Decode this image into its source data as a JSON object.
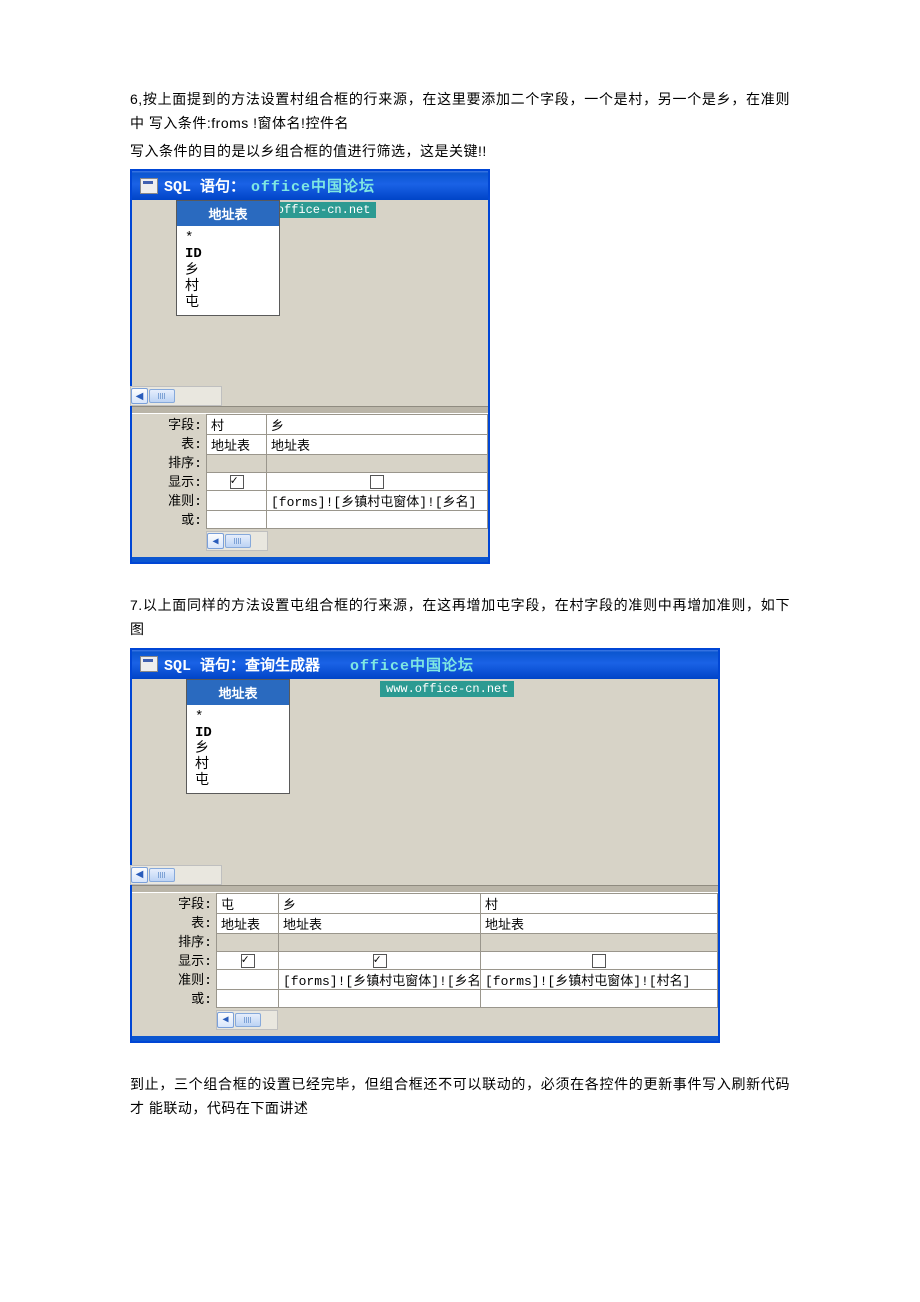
{
  "paragraphs": {
    "p1": "6,按上面提到的方法设置村组合框的行来源，在这里要添加二个字段，一个是村，另一个是乡，在准则中 写入条件:froms !窗体名!控件名",
    "p2": "写入条件的目的是以乡组合框的值进行筛选，这是关键!!",
    "p3": "7.以上面同样的方法设置屯组合框的行来源，在这再增加屯字段，在村字段的准则中再增加准则，如下图",
    "p4": "到止，三个组合框的设置已经完毕，但组合框还不可以联动的，必须在各控件的更新事件写入刷新代码才 能联动，代码在下面讲述"
  },
  "figure1": {
    "title_prefix": "SQL 语句：",
    "title_cyan": "office中国论坛",
    "watermark": "www.office-cn.net",
    "table_box": {
      "title": "地址表",
      "fields": [
        "*",
        "ID",
        "乡",
        "村",
        "屯"
      ]
    },
    "grid": {
      "labels": [
        "字段:",
        "表:",
        "排序:",
        "显示:",
        "准则:",
        "或:"
      ],
      "columns": [
        {
          "field": "村",
          "table": "地址表",
          "show": true,
          "criteria": ""
        },
        {
          "field": "乡",
          "table": "地址表",
          "show": false,
          "criteria": "[forms]![乡镇村屯窗体]![乡名]"
        }
      ]
    }
  },
  "figure2": {
    "title_prefix": "SQL 语句：",
    "title_sub": "查询生成器",
    "title_cyan": "office中国论坛",
    "watermark": "www.office-cn.net",
    "table_box": {
      "title": "地址表",
      "fields": [
        "*",
        "ID",
        "乡",
        "村",
        "屯"
      ]
    },
    "grid": {
      "labels": [
        "字段:",
        "表:",
        "排序:",
        "显示:",
        "准则:",
        "或:"
      ],
      "columns": [
        {
          "field": "屯",
          "table": "地址表",
          "show": true,
          "criteria": ""
        },
        {
          "field": "乡",
          "table": "地址表",
          "show": true,
          "criteria": "[forms]![乡镇村屯窗体]![乡名]"
        },
        {
          "field": "村",
          "table": "地址表",
          "show": false,
          "criteria": "[forms]![乡镇村屯窗体]![村名]"
        }
      ]
    }
  }
}
